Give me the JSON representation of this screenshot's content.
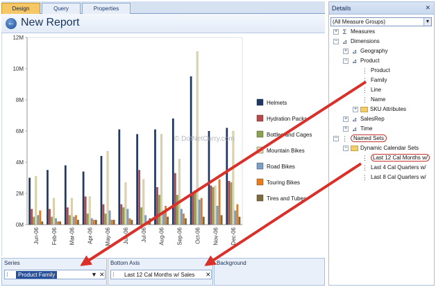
{
  "tabs": [
    "Design",
    "Query",
    "Properties"
  ],
  "report": {
    "title": "New Report",
    "back_icon": "back-arrow-icon"
  },
  "chart_data": {
    "type": "bar",
    "categories": [
      "Jun-06",
      "Feb-06",
      "Mar-06",
      "Apr-06",
      "May-06",
      "Jun-06",
      "Jul-06",
      "Aug-06",
      "Sep-06",
      "Oct-06",
      "Nov-06",
      "Dec-06"
    ],
    "ylim": [
      0,
      12000000
    ],
    "y_ticks": [
      "0M",
      "2M",
      "4M",
      "6M",
      "8M",
      "10M",
      "12M"
    ],
    "series": [
      {
        "name": "Helmets",
        "color": "#1f3864",
        "values": [
          3000000,
          3500000,
          3800000,
          3400000,
          4400000,
          6100000,
          5800000,
          6100000,
          6800000,
          9500000,
          6000000,
          6200000
        ]
      },
      {
        "name": "Hydration Packs",
        "color": "#b54a4a",
        "values": [
          1000000,
          1000000,
          1100000,
          1800000,
          1300000,
          1300000,
          3500000,
          2400000,
          3300000,
          2000000,
          2500000,
          2800000
        ]
      },
      {
        "name": "Bottles and Cages",
        "color": "#8ca252",
        "values": [
          500000,
          500000,
          600000,
          700000,
          700000,
          1100000,
          1100000,
          1900000,
          1900000,
          2200000,
          2400000,
          2700000
        ]
      },
      {
        "name": "Mountain Bikes",
        "color": "#e1d4a8",
        "values": [
          3100000,
          1700000,
          1700000,
          1800000,
          4700000,
          2700000,
          2900000,
          5800000,
          4200000,
          11100000,
          2500000,
          6000000
        ]
      },
      {
        "name": "Road Bikes",
        "color": "#7b9ec4",
        "values": [
          600000,
          400000,
          500000,
          400000,
          900000,
          1000000,
          600000,
          900000,
          1000000,
          1600000,
          1200000,
          900000
        ]
      },
      {
        "name": "Touring Bikes",
        "color": "#e87d1e",
        "values": [
          900000,
          200000,
          600000,
          300000,
          300000,
          400000,
          200000,
          1200000,
          700000,
          1700000,
          2900000,
          1300000
        ]
      },
      {
        "name": "Tires and Tubes",
        "color": "#7d6b3e",
        "values": [
          200000,
          200000,
          300000,
          300000,
          300000,
          300000,
          400000,
          500000,
          400000,
          500000,
          600000,
          500000
        ]
      }
    ],
    "watermark": "© DotNetCurry.com"
  },
  "panels": {
    "series": {
      "title": "Series",
      "field": "Product Family",
      "dropdown": "▼",
      "close": "✕"
    },
    "bottom_axis": {
      "title": "Bottom Axis",
      "field": "Last 12 Cal Months w/ Sales",
      "close": "✕"
    },
    "background": {
      "title": "Background"
    }
  },
  "details": {
    "title": "Details",
    "close": "✕",
    "dropdown": "(All Measure Groups)",
    "tree": [
      {
        "label": "Measures",
        "exp": "+",
        "icon": "sigma-icon",
        "glyph": "Σ",
        "indent": 0
      },
      {
        "label": "Dimensions",
        "exp": "−",
        "icon": "dimension-icon",
        "glyph": "⊿",
        "indent": 0
      },
      {
        "label": "Geography",
        "exp": "+",
        "icon": "dimension-icon",
        "glyph": "⊿",
        "indent": 1
      },
      {
        "label": "Product",
        "exp": "−",
        "icon": "dimension-icon",
        "glyph": "⊿",
        "indent": 1
      },
      {
        "label": "Product",
        "exp": "",
        "icon": "level-icon",
        "glyph": "⋮",
        "indent": 2
      },
      {
        "label": "Family",
        "exp": "",
        "icon": "level-icon",
        "glyph": "⋮",
        "indent": 2
      },
      {
        "label": "Line",
        "exp": "",
        "icon": "level-icon",
        "glyph": "⋮",
        "indent": 2
      },
      {
        "label": "Name",
        "exp": "",
        "icon": "level-icon",
        "glyph": "⋮",
        "indent": 2
      },
      {
        "label": "SKU Attributes",
        "exp": "+",
        "icon": "folder-icon",
        "glyph": "",
        "indent": 2
      },
      {
        "label": "SalesRep",
        "exp": "+",
        "icon": "dimension-icon",
        "glyph": "⊿",
        "indent": 1
      },
      {
        "label": "Time",
        "exp": "+",
        "icon": "dimension-icon",
        "glyph": "⊿",
        "indent": 1
      },
      {
        "label": "Named Sets",
        "exp": "−",
        "icon": "named-set-icon",
        "glyph": "⋮",
        "indent": 0
      },
      {
        "label": "Dynamic Calendar Sets",
        "exp": "−",
        "icon": "folder-icon",
        "glyph": "",
        "indent": 1
      },
      {
        "label": "Last 12 Cal Months w/",
        "exp": "",
        "icon": "named-set-icon",
        "glyph": "⋮",
        "indent": 2
      },
      {
        "label": "Last 4 Cal Quarters w/",
        "exp": "",
        "icon": "named-set-icon",
        "glyph": "⋮",
        "indent": 2
      },
      {
        "label": "Last 8 Cal Quarters w/",
        "exp": "",
        "icon": "named-set-icon",
        "glyph": "⋮",
        "indent": 2
      }
    ]
  },
  "accent_colors": {
    "arrow": "#d9302a",
    "selection": "#254f9a",
    "active_tab": "#f6c766"
  }
}
